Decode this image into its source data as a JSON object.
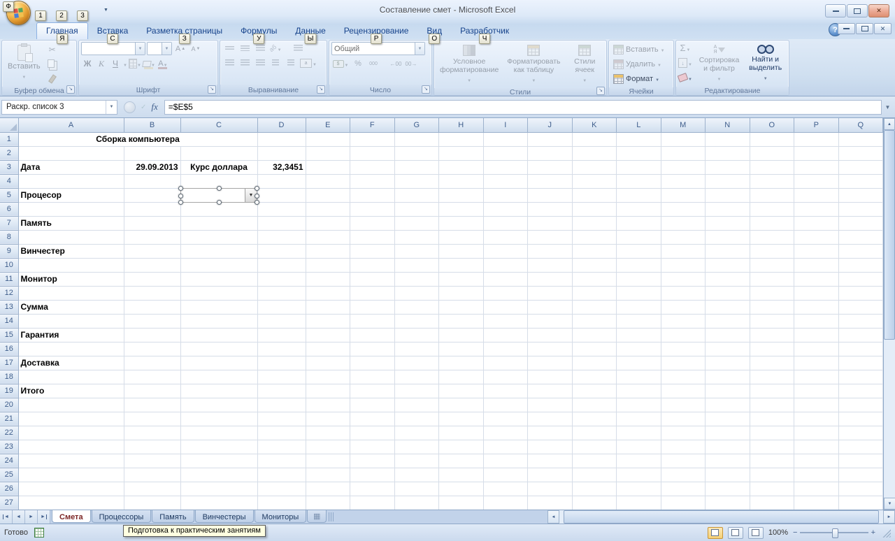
{
  "window": {
    "title": "Составление смет - Microsoft Excel",
    "office_keytip": "Ф",
    "qat_keytips": [
      "1",
      "2",
      "3"
    ]
  },
  "ribbon": {
    "tabs": [
      {
        "label": "Главная",
        "keytip": "Я",
        "active": true
      },
      {
        "label": "Вставка",
        "keytip": "С",
        "active": false
      },
      {
        "label": "Разметка страницы",
        "keytip": "З",
        "active": false
      },
      {
        "label": "Формулы",
        "keytip": "У",
        "active": false
      },
      {
        "label": "Данные",
        "keytip": "Ы",
        "active": false
      },
      {
        "label": "Рецензирование",
        "keytip": "Р",
        "active": false
      },
      {
        "label": "Вид",
        "keytip": "О",
        "active": false
      },
      {
        "label": "Разработчик",
        "keytip": "Ч",
        "active": false
      }
    ],
    "clipboard": {
      "label": "Буфер обмена",
      "paste": "Вставить"
    },
    "font": {
      "label": "Шрифт",
      "bold": "Ж",
      "italic": "К",
      "underline": "Ч"
    },
    "alignment": {
      "label": "Выравнивание"
    },
    "number": {
      "label": "Число",
      "format": "Общий"
    },
    "styles": {
      "label": "Стили",
      "conditional": "Условное форматирование",
      "format_table": "Форматировать как таблицу",
      "cell_styles": "Стили ячеек"
    },
    "cells": {
      "label": "Ячейки",
      "insert": "Вставить",
      "delete": "Удалить",
      "format": "Формат"
    },
    "editing": {
      "label": "Редактирование",
      "sort_filter": "Сортировка и фильтр",
      "find_select": "Найти и выделить"
    }
  },
  "formula_bar": {
    "name_box": "Раскр. список 3",
    "fx": "fx",
    "formula": "=$E$5"
  },
  "grid": {
    "columns": [
      "A",
      "B",
      "C",
      "D",
      "E",
      "F",
      "G",
      "H",
      "I",
      "J",
      "K",
      "L",
      "M",
      "N",
      "O",
      "P",
      "Q"
    ],
    "row_count": 27,
    "cells": [
      {
        "ref": "A1",
        "text": "Сборка компьютера",
        "bold": true,
        "align": "center",
        "colspan": 3
      },
      {
        "ref": "A3",
        "text": "Дата",
        "bold": true,
        "align": "left"
      },
      {
        "ref": "B3",
        "text": "29.09.2013",
        "bold": true,
        "align": "right"
      },
      {
        "ref": "C3",
        "text": "Курс доллара",
        "bold": true,
        "align": "center"
      },
      {
        "ref": "D3",
        "text": "32,3451",
        "bold": true,
        "align": "right"
      },
      {
        "ref": "A5",
        "text": "Процесор",
        "bold": true,
        "align": "left"
      },
      {
        "ref": "A7",
        "text": "Память",
        "bold": true,
        "align": "left"
      },
      {
        "ref": "A9",
        "text": "Винчестер",
        "bold": true,
        "align": "left"
      },
      {
        "ref": "A11",
        "text": "Монитор",
        "bold": true,
        "align": "left"
      },
      {
        "ref": "A13",
        "text": "Сумма",
        "bold": true,
        "align": "left"
      },
      {
        "ref": "A15",
        "text": "Гарантия",
        "bold": true,
        "align": "left"
      },
      {
        "ref": "A17",
        "text": "Доставка",
        "bold": true,
        "align": "left"
      },
      {
        "ref": "A19",
        "text": "Итого",
        "bold": true,
        "align": "left"
      }
    ]
  },
  "sheet_tabs": [
    {
      "label": "Смета",
      "active": true
    },
    {
      "label": "Процессоры",
      "active": false
    },
    {
      "label": "Память",
      "active": false
    },
    {
      "label": "Винчестеры",
      "active": false
    },
    {
      "label": "Мониторы",
      "active": false
    }
  ],
  "status_bar": {
    "mode": "Готово",
    "tooltip": "Подготовка к практическим занятиям",
    "zoom": "100%"
  }
}
